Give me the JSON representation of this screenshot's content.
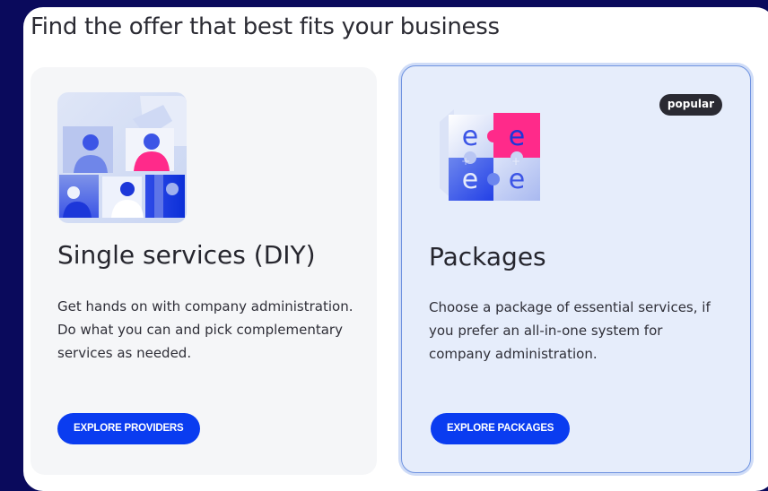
{
  "page": {
    "title": "Find the offer that best fits your business"
  },
  "offers": [
    {
      "title": "Single services (DIY)",
      "description": "Get hands on with company administration. Do what you can and pick complementary services as needed.",
      "button_label": "EXPLORE PROVIDERS",
      "icon": "people-grid-illustration"
    },
    {
      "title": "Packages",
      "description": "Choose a package of essential services, if you prefer an all-in-one system for company administration.",
      "button_label": "EXPLORE PACKAGES",
      "badge": "popular",
      "icon": "puzzle-pieces-illustration",
      "puzzle_letter": "e"
    }
  ],
  "colors": {
    "background": "#0a0a5c",
    "accent": "#0a3cf0",
    "pink": "#ff2a8a",
    "highlight_card": "#e6edfb",
    "badge": "#2a2a32"
  }
}
